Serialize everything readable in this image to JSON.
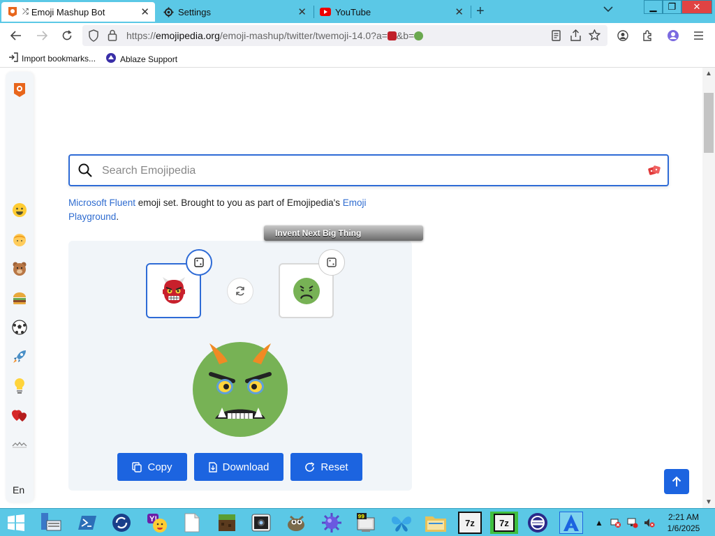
{
  "browser": {
    "tabs": [
      {
        "label": "Emoji Mashup Bot",
        "active": true
      },
      {
        "label": "Settings",
        "active": false
      },
      {
        "label": "YouTube",
        "active": false
      }
    ],
    "url_prefix": "https://",
    "url_host": "emojipedia.org",
    "url_path": "/emoji-mashup/twitter/twemoji-14.0?a=",
    "url_mid": "&b=",
    "bookmarks": [
      {
        "label": "Import bookmarks..."
      },
      {
        "label": "Ablaze Support"
      }
    ]
  },
  "page": {
    "search_placeholder": "Search Emojipedia",
    "intro": {
      "link1": "Microsoft Fluent",
      "text1": " emoji set. Brought to you as part of Emojipedia's ",
      "link2": "Emoji",
      "link3": "Playground",
      "end": "."
    },
    "invent_label": "Invent Next Big Thing",
    "buttons": {
      "copy": "Copy",
      "download": "Download",
      "reset": "Reset"
    },
    "sidebar_lang": "En"
  },
  "taskbar": {
    "time": "2:21 AM",
    "date": "1/6/2025",
    "app_labels": {
      "sevenzip1": "7z",
      "sevenzip2": "7z"
    }
  },
  "colors": {
    "accent": "#1c64e0",
    "titlebar": "#5bc8e6",
    "link": "#2f6cd0"
  }
}
